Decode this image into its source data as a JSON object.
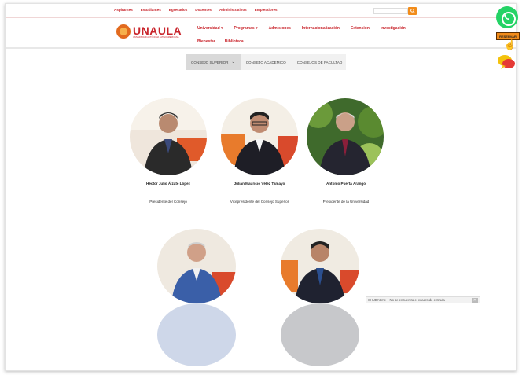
{
  "topbar": {
    "links": [
      "Aspirantes",
      "Estudiantes",
      "Egresados",
      "Docentes",
      "Administrativos",
      "Empleadores"
    ],
    "search_placeholder": ""
  },
  "brand": {
    "name": "UNAULA",
    "tagline": "UNIVERSIDAD AUTÓNOMA LATINOAMERICANA"
  },
  "nav": {
    "row1": [
      "Universidad ▾",
      "Programas ▾",
      "Admisiones",
      "Internacionalización",
      "Extensión",
      "Investigación"
    ],
    "row2": [
      "Bienestar",
      "Biblioteca"
    ]
  },
  "tabs": {
    "items": [
      "CONSEJO SUPERIOR",
      "CONSEJO ACADÉMICO",
      "CONSEJOS DE FACULTAD"
    ],
    "active": "CONSEJO SUPERIOR"
  },
  "members": [
    {
      "name": "Héctor Julio Álzate López",
      "role": "Presidente del Consejo"
    },
    {
      "name": "Julián Mauricio Vélez Tamayo",
      "role": "Vicepresidente del Consejo Superior"
    },
    {
      "name": "Antonio Puerta Arango",
      "role": "Presidente de la Universidad"
    },
    {
      "name": "",
      "role": ""
    },
    {
      "name": "",
      "role": ""
    }
  ],
  "status": {
    "text": "SHUB'nt.me – No se encuentra el cuadro de entrada",
    "close": "✕"
  },
  "floating": {
    "whatsapp_icon": "whatsapp-icon",
    "reservar_label": "RESERVAR",
    "hand_icon": "pointer-hand-icon",
    "chat_icon": "chat-bubble-icon"
  },
  "colors": {
    "brand_red": "#c9252c",
    "accent_orange": "#f28c1a",
    "whatsapp_green": "#25d366"
  }
}
